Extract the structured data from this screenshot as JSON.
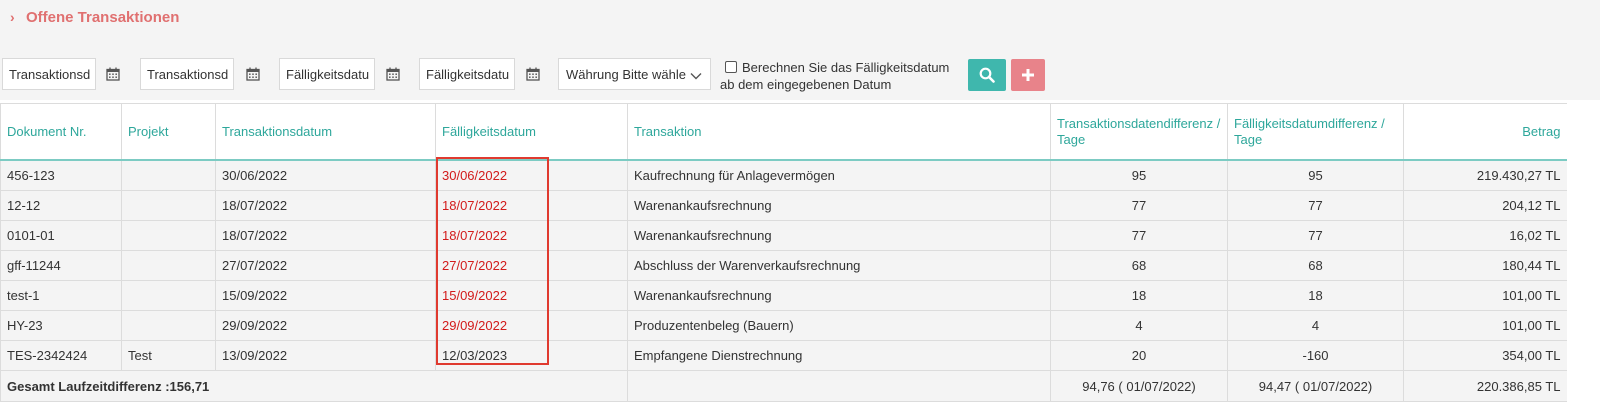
{
  "header": {
    "title": "Offene Transaktionen",
    "chevron_icon": "chevron-right-icon"
  },
  "filters": {
    "date_from": "Transaktionsd",
    "date_to": "Transaktionsd",
    "due_from": "Fälligkeitsdatu",
    "due_to": "Fälligkeitsdatu",
    "currency": "Währung Bitte wähle",
    "checkbox_line1": "Berechnen Sie das Fälligkeitsdatum",
    "checkbox_line2": "ab dem eingegebenen Datum",
    "checkbox_checked": false,
    "search_icon": "search-icon",
    "add_icon": "plus-icon",
    "search_color": "#3fb7ad",
    "add_color": "#e8838a"
  },
  "table": {
    "headers": {
      "doc": "Dokument Nr.",
      "project": "Projekt",
      "trans_date": "Transaktionsdatum",
      "due_date": "Fälligkeitsdatum",
      "transaction": "Transaktion",
      "trans_diff": "Transaktionsdatendifferenz / Tage",
      "due_diff": "Fälligkeitsdatumdifferenz / Tage",
      "amount": "Betrag"
    },
    "rows": [
      {
        "doc": "456-123",
        "project": "",
        "trans_date": "30/06/2022",
        "due_date": "30/06/2022",
        "due_overdue": true,
        "transaction": "Kaufrechnung für Anlagevermögen",
        "trans_diff": "95",
        "due_diff": "95",
        "amount": "219.430,27 TL"
      },
      {
        "doc": "12-12",
        "project": "",
        "trans_date": "18/07/2022",
        "due_date": "18/07/2022",
        "due_overdue": true,
        "transaction": "Warenankaufsrechnung",
        "trans_diff": "77",
        "due_diff": "77",
        "amount": "204,12 TL"
      },
      {
        "doc": "0101-01",
        "project": "",
        "trans_date": "18/07/2022",
        "due_date": "18/07/2022",
        "due_overdue": true,
        "transaction": "Warenankaufsrechnung",
        "trans_diff": "77",
        "due_diff": "77",
        "amount": "16,02 TL"
      },
      {
        "doc": "gff-11244",
        "project": "",
        "trans_date": "27/07/2022",
        "due_date": "27/07/2022",
        "due_overdue": true,
        "transaction": "Abschluss der Warenverkaufsrechnung",
        "trans_diff": "68",
        "due_diff": "68",
        "amount": "180,44 TL"
      },
      {
        "doc": "test-1",
        "project": "",
        "trans_date": "15/09/2022",
        "due_date": "15/09/2022",
        "due_overdue": true,
        "transaction": "Warenankaufsrechnung",
        "trans_diff": "18",
        "due_diff": "18",
        "amount": "101,00 TL"
      },
      {
        "doc": "HY-23",
        "project": "",
        "trans_date": "29/09/2022",
        "due_date": "29/09/2022",
        "due_overdue": true,
        "transaction": "Produzentenbeleg (Bauern)",
        "trans_diff": "4",
        "due_diff": "4",
        "amount": "101,00 TL"
      },
      {
        "doc": "TES-2342424",
        "project": "Test",
        "trans_date": "13/09/2022",
        "due_date": "12/03/2023",
        "due_overdue": false,
        "transaction": "Empfangene Dienstrechnung",
        "trans_diff": "20",
        "due_diff": "-160",
        "amount": "354,00 TL"
      }
    ],
    "footer": {
      "label": "Gesamt Laufzeitdifferenz :156,71",
      "trans_diff": "94,76 ( 01/07/2022)",
      "due_diff": "94,47 ( 01/07/2022)",
      "amount": "220.386,85 TL"
    },
    "overdue_color": "#d21b1b",
    "header_color": "#2ea79b"
  }
}
